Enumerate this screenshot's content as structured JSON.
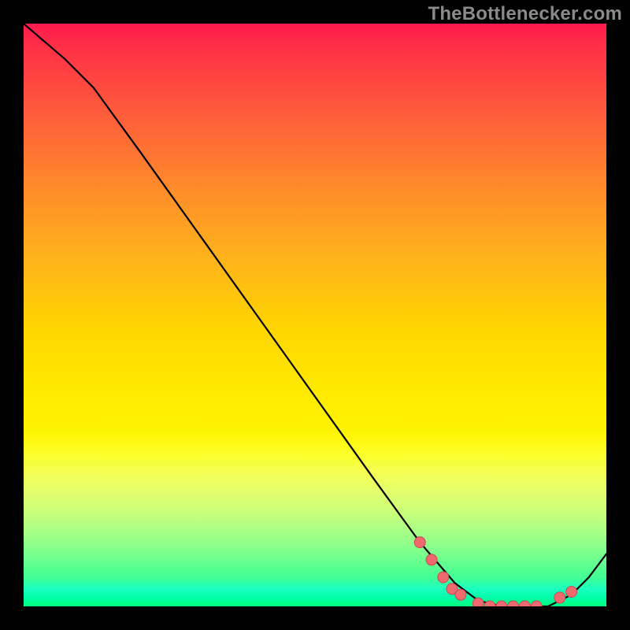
{
  "attribution": "TheBottlenecker.com",
  "chart_data": {
    "type": "line",
    "title": "",
    "xlabel": "",
    "ylabel": "",
    "xlim": [
      0,
      100
    ],
    "ylim": [
      0,
      100
    ],
    "series": [
      {
        "name": "bottleneck-curve",
        "x": [
          0,
          7,
          12,
          20,
          30,
          40,
          50,
          60,
          68,
          74,
          78,
          82,
          86,
          90,
          94,
          97,
          100
        ],
        "y": [
          100,
          94,
          89,
          78,
          64,
          50,
          36,
          22,
          11,
          4,
          1,
          0,
          0,
          0,
          2,
          5,
          9
        ]
      }
    ],
    "markers": {
      "name": "highlight-dots",
      "points": [
        {
          "x": 68,
          "y": 11
        },
        {
          "x": 70,
          "y": 8
        },
        {
          "x": 72,
          "y": 5
        },
        {
          "x": 73.5,
          "y": 3
        },
        {
          "x": 75,
          "y": 2
        },
        {
          "x": 78,
          "y": 0.5
        },
        {
          "x": 80,
          "y": 0
        },
        {
          "x": 82,
          "y": 0
        },
        {
          "x": 84,
          "y": 0
        },
        {
          "x": 86,
          "y": 0
        },
        {
          "x": 88,
          "y": 0
        },
        {
          "x": 92,
          "y": 1.5
        },
        {
          "x": 94,
          "y": 2.5
        }
      ]
    },
    "gradient_stops": [
      {
        "pos": 0,
        "color": "#ff1a4d"
      },
      {
        "pos": 50,
        "color": "#ffd400"
      },
      {
        "pos": 100,
        "color": "#00ff7a"
      }
    ]
  }
}
